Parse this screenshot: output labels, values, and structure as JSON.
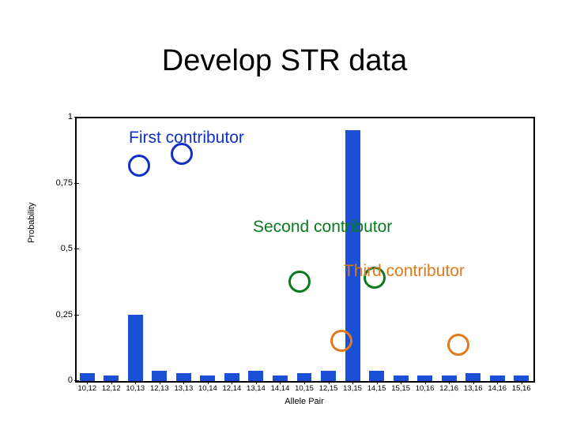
{
  "title": "Develop STR data",
  "annotations": {
    "first": "First contributor",
    "second": "Second contributor",
    "third": "Third contributor"
  },
  "chart_data": {
    "type": "bar",
    "title": "",
    "xlabel": "Allele Pair",
    "ylabel": "Probability",
    "ylim": [
      0,
      1
    ],
    "yticks": [
      0,
      0.25,
      0.5,
      0.75,
      1
    ],
    "ytick_labels": [
      "0",
      "0,25",
      "0,5",
      "0,75",
      "1"
    ],
    "categories": [
      "10,12",
      "12,12",
      "10,13",
      "12,13",
      "13,13",
      "10,14",
      "12,14",
      "13,14",
      "14,14",
      "10,15",
      "12,15",
      "13,15",
      "14,15",
      "15,15",
      "10,16",
      "12,16",
      "13,16",
      "14,16",
      "15,16"
    ],
    "values": [
      0.03,
      0.02,
      0.25,
      0.04,
      0.03,
      0.02,
      0.03,
      0.04,
      0.02,
      0.03,
      0.04,
      0.95,
      0.04,
      0.02,
      0.02,
      0.02,
      0.03,
      0.02,
      0.02
    ],
    "circle_markers": [
      {
        "series": "first",
        "color": "blue",
        "over_category": "10,13"
      },
      {
        "series": "first",
        "color": "blue",
        "over_category": "13,13"
      },
      {
        "series": "second",
        "color": "green",
        "over_category": "10,15"
      },
      {
        "series": "second",
        "color": "green",
        "over_category": "14,15"
      },
      {
        "series": "third",
        "color": "orange",
        "over_category": "12,15"
      },
      {
        "series": "third",
        "color": "orange",
        "over_category": "12,16"
      }
    ]
  }
}
